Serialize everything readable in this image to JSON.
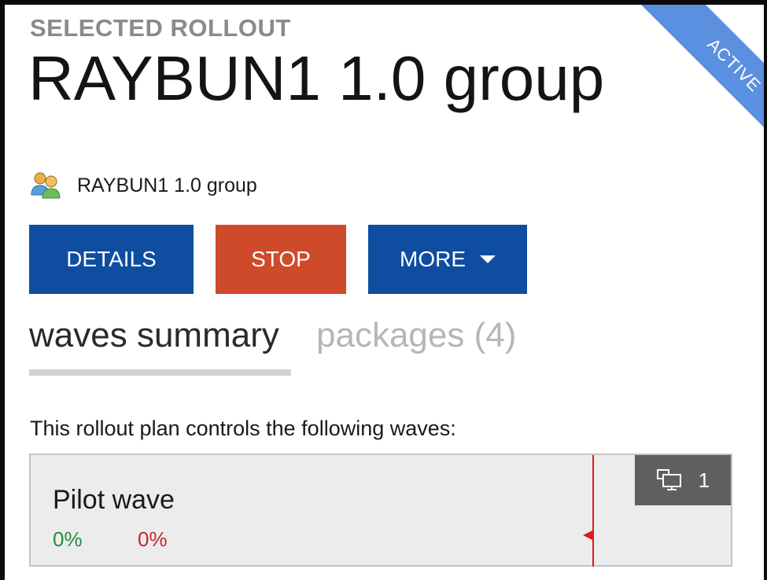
{
  "header": {
    "eyebrow": "SELECTED ROLLOUT",
    "title": "RAYBUN1 1.0 group",
    "status_ribbon": "ACTIVE"
  },
  "group": {
    "icon": "users-group-icon",
    "label": "RAYBUN1 1.0 group"
  },
  "actions": {
    "details_label": "DETAILS",
    "stop_label": "STOP",
    "more_label": "MORE"
  },
  "tabs": [
    {
      "label": "waves summary",
      "selected": true
    },
    {
      "label": "packages (4)",
      "selected": false
    }
  ],
  "waves_section": {
    "intro": "This rollout plan controls the following waves:",
    "waves": [
      {
        "name": "Pilot wave",
        "success_percent": "0%",
        "failure_percent": "0%",
        "device_count": "1",
        "device_icon": "devices-icon"
      }
    ]
  },
  "colors": {
    "primary_blue": "#0e4da0",
    "stop_red": "#cf4a2a",
    "ribbon_blue": "#5b8fe0",
    "success_green": "#2c8a3e",
    "failure_red": "#c0282d",
    "badge_gray": "#5f5f5f"
  }
}
